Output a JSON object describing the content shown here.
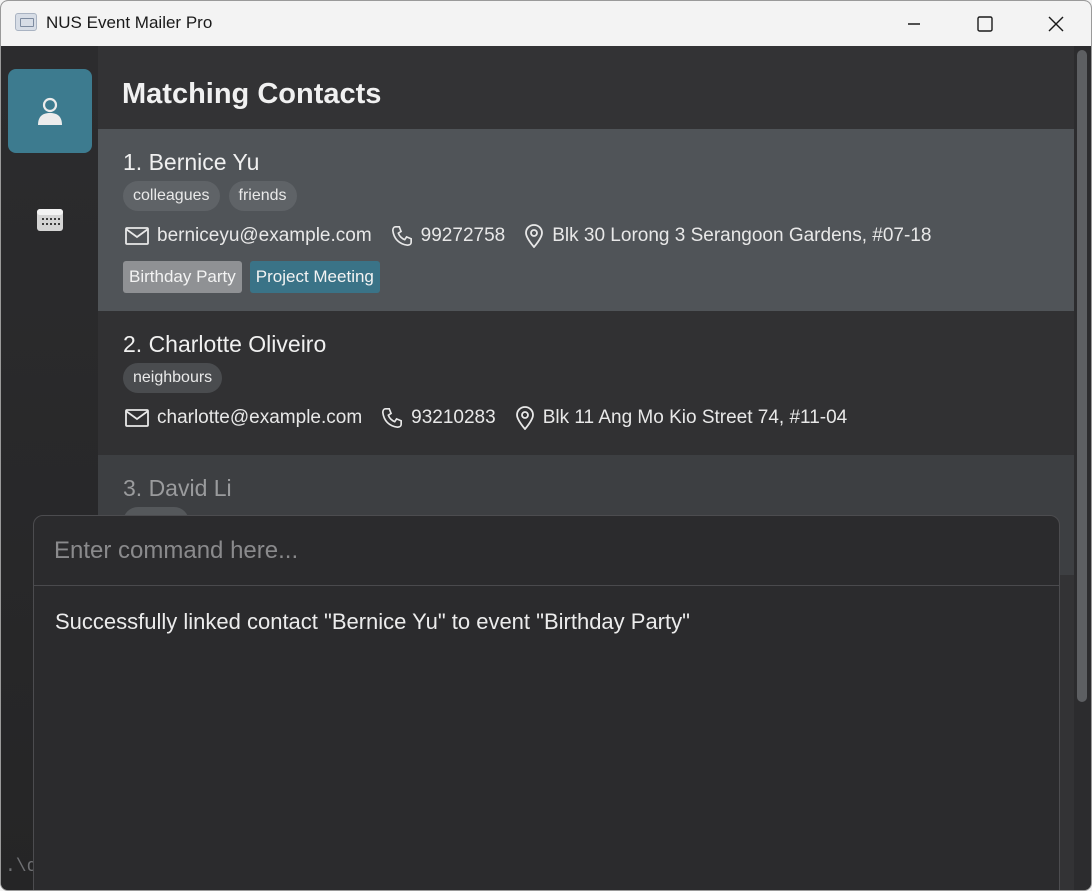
{
  "window": {
    "title": "NUS Event Mailer Pro"
  },
  "sidebar": {
    "items": [
      {
        "icon": "person-icon",
        "active": true
      },
      {
        "icon": "calendar-icon",
        "active": false
      }
    ]
  },
  "main": {
    "heading": "Matching Contacts",
    "contacts": [
      {
        "name": "1. Bernice Yu",
        "tags": [
          "colleagues",
          "friends"
        ],
        "email": "berniceyu@example.com",
        "phone": "99272758",
        "address": "Blk 30 Lorong 3 Serangoon Gardens, #07-18",
        "events": [
          "Birthday Party",
          "Project Meeting"
        ]
      },
      {
        "name": "2. Charlotte Oliveiro",
        "tags": [
          "neighbours"
        ],
        "email": "charlotte@example.com",
        "phone": "93210283",
        "address": "Blk 11 Ang Mo Kio Street 74, #11-04",
        "events": []
      },
      {
        "name": "3. David Li",
        "tags": [
          ""
        ],
        "events": []
      }
    ]
  },
  "command": {
    "placeholder": "Enter command here...",
    "value": "",
    "result": "Successfully linked contact \"Bernice Yu\" to event \"Birthday Party\""
  },
  "footer": {
    "path_fragment": ".\\d"
  },
  "colors": {
    "accent": "#3d7b8f",
    "selected_card": "#505458",
    "event_teal": "#3a7387",
    "event_grey": "#8f9194"
  }
}
